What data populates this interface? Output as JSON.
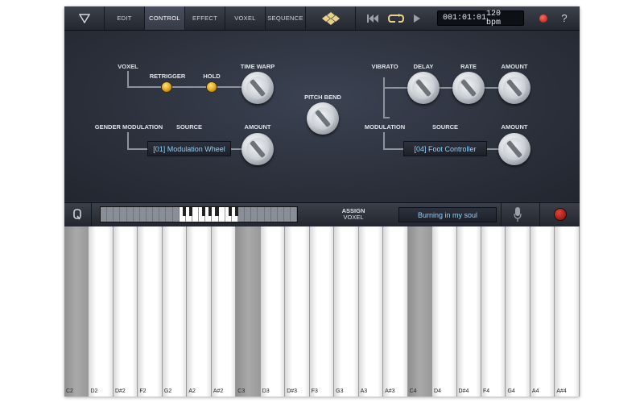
{
  "toolbar": {
    "tabs": [
      "EDIT",
      "CONTROL",
      "EFFECT",
      "VOXEL",
      "SEQUENCE"
    ],
    "active_tab": "CONTROL",
    "position": "001:01:01",
    "tempo": "120 bpm",
    "help": "?"
  },
  "panel": {
    "voxel_label": "VOXEL",
    "retrigger_label": "RETRIGGER",
    "hold_label": "HOLD",
    "time_warp_label": "TIME WARP",
    "pitch_bend_label": "PITCH BEND",
    "gender_mod_label": "GENDER MODULATION",
    "source_label_left": "SOURCE",
    "amount_label_left": "AMOUNT",
    "source_left_value": "[01] Modulation Wheel",
    "vibrato_label": "VIBRATO",
    "delay_label": "DELAY",
    "rate_label": "RATE",
    "amount_label_top": "AMOUNT",
    "modulation_label": "MODULATION",
    "source_label_right": "SOURCE",
    "amount_label_right": "AMOUNT",
    "source_right_value": "[04] Foot Controller"
  },
  "strip": {
    "assign_label": "ASSIGN",
    "voxel_label": "VOXEL",
    "song": "Burning in my soul"
  },
  "keyboard": {
    "keys": [
      "C2",
      "D2",
      "D#2",
      "F2",
      "G2",
      "A2",
      "A#2",
      "C3",
      "D3",
      "D#3",
      "F3",
      "G3",
      "A3",
      "A#3",
      "C4",
      "D4",
      "D#4",
      "F4",
      "G4",
      "A4",
      "A#4"
    ],
    "dimmed": [
      "C2",
      "C3",
      "C4"
    ]
  },
  "colors": {
    "accent": "#8fd2ff",
    "led": "#e0a21c",
    "record": "#c0201c"
  }
}
